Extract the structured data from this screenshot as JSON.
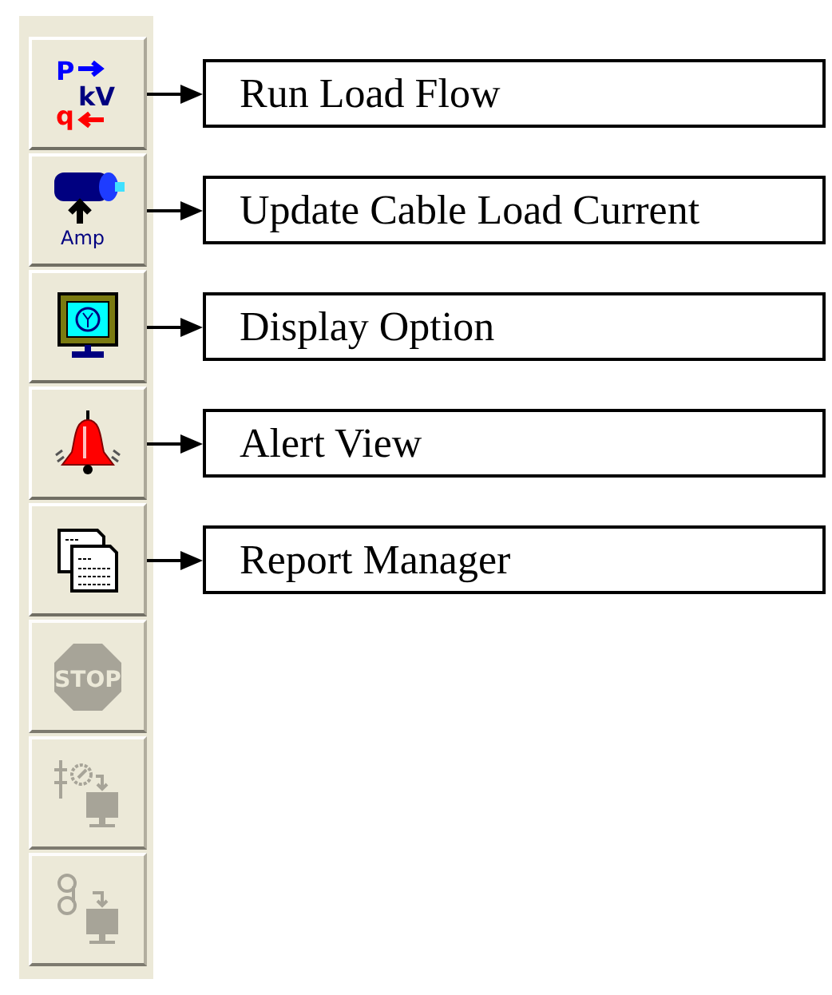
{
  "toolbar": {
    "buttons": [
      {
        "kind": "load-flow",
        "texts": [
          "P",
          "kV",
          "q"
        ],
        "disabled": false,
        "callout": "Run Load Flow"
      },
      {
        "kind": "cable-current",
        "texts": [
          "Amp"
        ],
        "disabled": false,
        "callout": "Update Cable Load Current"
      },
      {
        "kind": "display",
        "disabled": false,
        "callout": "Display Option"
      },
      {
        "kind": "alert",
        "disabled": false,
        "callout": "Alert View"
      },
      {
        "kind": "report",
        "disabled": false,
        "callout": "Report Manager"
      },
      {
        "kind": "stop",
        "texts": [
          "STOP"
        ],
        "disabled": true
      },
      {
        "kind": "meter-export",
        "disabled": true
      },
      {
        "kind": "tape-export",
        "disabled": true
      }
    ]
  }
}
